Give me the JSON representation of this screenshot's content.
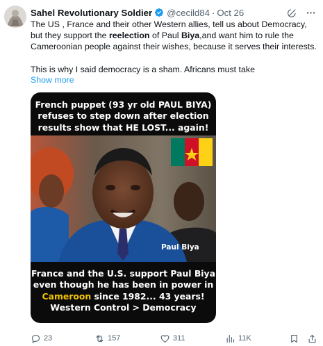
{
  "tweet": {
    "author_name": "Sahel Revolutionary Soldier",
    "handle": "@cecild84",
    "separator": "·",
    "date": "Oct 26",
    "text_line1_start": "The US , France and their  other Western allies, tell us about Democracy, but they support the ",
    "text_bold1": "reelection",
    "text_mid": " of Paul ",
    "text_bold2": "Biya",
    "text_end": ",and want him to rule the Cameroonian people against their wishes, because it serves their interests.",
    "text_para2": "This is why I said democracy is a sham. Africans must take",
    "show_more": "Show more"
  },
  "media": {
    "caption_top": "French puppet (93 yr old PAUL BIYA) refuses to step down after election results show that HE LOST... again!",
    "caption_bottom_1": "France and the U.S. support Paul Biya even though he has been in power in",
    "caption_bottom_highlight": "Cameroon",
    "caption_bottom_2": " since 1982... 43 years!",
    "caption_bottom_3": "Western Control > Democracy",
    "photo_label": "Paul Biya",
    "flag_colors": [
      "#007a5e",
      "#ce1126",
      "#fcd116"
    ]
  },
  "actions": {
    "replies": "23",
    "reposts": "157",
    "likes": "311",
    "views": "11K"
  },
  "colors": {
    "link": "#1d9bf0",
    "secondary": "#536471",
    "verified": "#1d9bf0"
  },
  "icons": [
    "grok-icon",
    "more-icon",
    "reply-icon",
    "repost-icon",
    "like-icon",
    "views-icon",
    "bookmark-icon",
    "share-icon",
    "verified-badge-icon"
  ]
}
